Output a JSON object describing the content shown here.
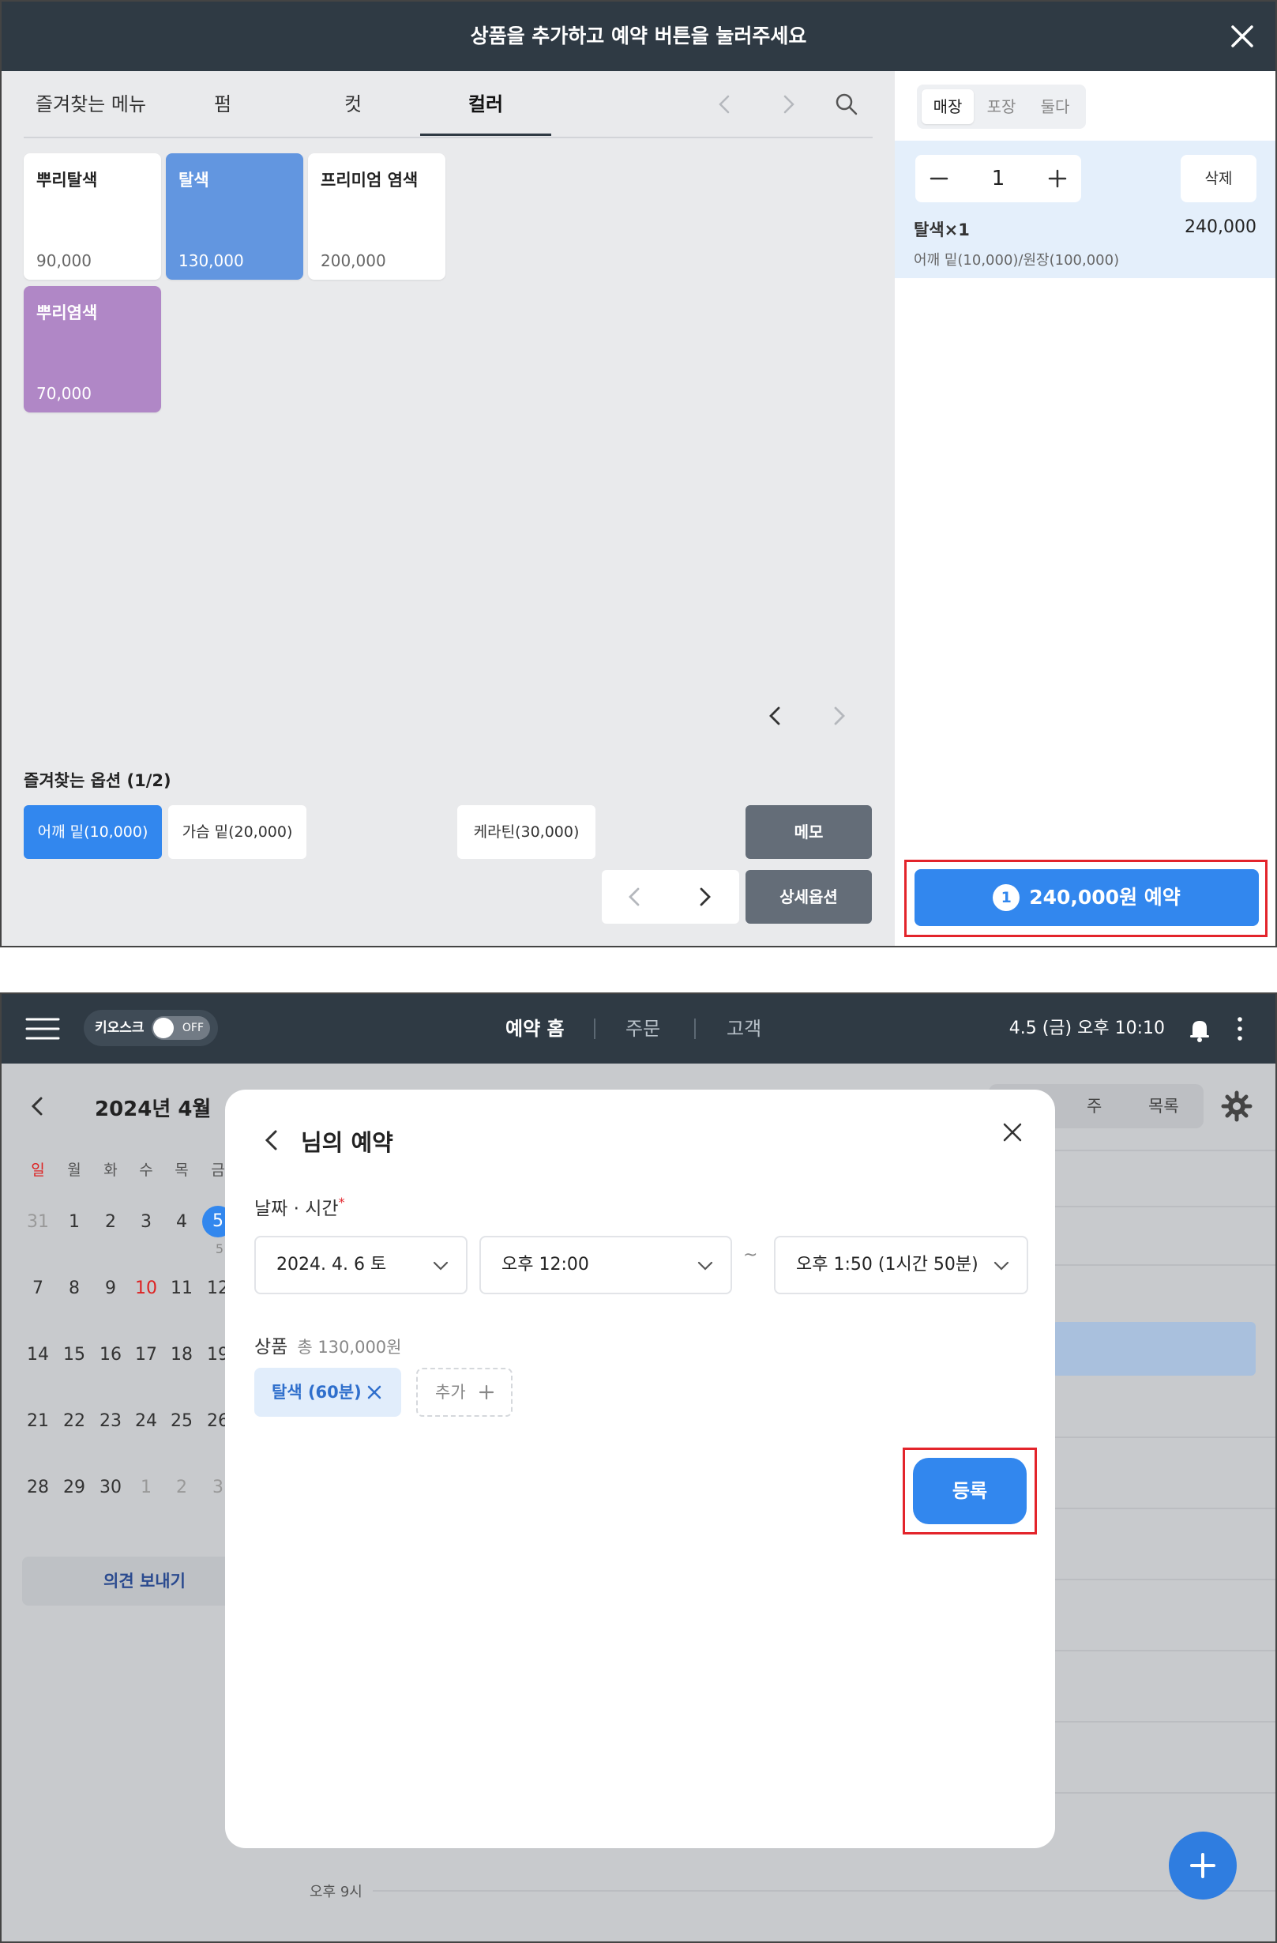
{
  "panel1": {
    "header_title": "상품을 추가하고 예약 버튼을 눌러주세요",
    "tabs": [
      {
        "label": "즐겨찾는 메뉴"
      },
      {
        "label": "펌"
      },
      {
        "label": "컷"
      },
      {
        "label": "컬러"
      }
    ],
    "products": [
      {
        "name": "뿌리탈색",
        "price": "90,000"
      },
      {
        "name": "탈색",
        "price": "130,000"
      },
      {
        "name": "프리미엄 염색",
        "price": "200,000"
      },
      {
        "name": "뿌리염색",
        "price": "70,000"
      }
    ],
    "fav_options_title": "즐겨찾는 옵션 (1/2)",
    "options": [
      {
        "label": "어깨 밑(10,000)"
      },
      {
        "label": "가슴 밑(20,000)"
      },
      {
        "label": "케라틴(30,000)"
      }
    ],
    "memo_label": "메모",
    "detail_options_label": "상세옵션",
    "order_type_tabs": [
      "매장",
      "포장",
      "둘다"
    ],
    "cart": {
      "quantity": "1",
      "delete_label": "삭제",
      "item_name": "탈색×1",
      "item_price": "240,000",
      "item_options": "어깨 밑(10,000)/원장(100,000)"
    },
    "reserve": {
      "count": "1",
      "label": "240,000원 예약"
    },
    "colors": {
      "accent": "#3287ee",
      "header": "#2f3a44",
      "card_blue": "#6296e0",
      "card_purple": "#b087c6",
      "highlight": "#e3242b"
    }
  },
  "panel2": {
    "kiosk_label": "키오스크",
    "kiosk_state": "OFF",
    "nav": [
      "예약 홈",
      "주문",
      "고객"
    ],
    "datetime": "4.5 (금) 오후 10:10",
    "calendar": {
      "month": "2024년 4월",
      "weekdays": [
        "일",
        "월",
        "화",
        "수",
        "목",
        "금"
      ],
      "weeks": [
        [
          "31",
          "1",
          "2",
          "3",
          "4",
          "5"
        ],
        [
          "7",
          "8",
          "9",
          "10",
          "11",
          "12"
        ],
        [
          "14",
          "15",
          "16",
          "17",
          "18",
          "19"
        ],
        [
          "21",
          "22",
          "23",
          "24",
          "25",
          "26"
        ],
        [
          "28",
          "29",
          "30",
          "1",
          "2",
          "3"
        ]
      ],
      "selected_badge": "5"
    },
    "feedback_label": "의견 보내기",
    "view_tabs": [
      "주",
      "목록"
    ],
    "time_label": "오후 9시",
    "modal": {
      "title": "님의 예약",
      "datetime_label": "날짜 · 시간",
      "required_mark": "*",
      "date_value": "2024. 4. 6 토",
      "start_time": "오후 12:00",
      "tilde": "~",
      "end_time": "오후 1:50 (1시간 50분)",
      "product_label": "상품",
      "product_total": "총 130,000원",
      "chip_label": "탈색 (60분)",
      "add_label": "추가",
      "register_label": "등록"
    }
  }
}
